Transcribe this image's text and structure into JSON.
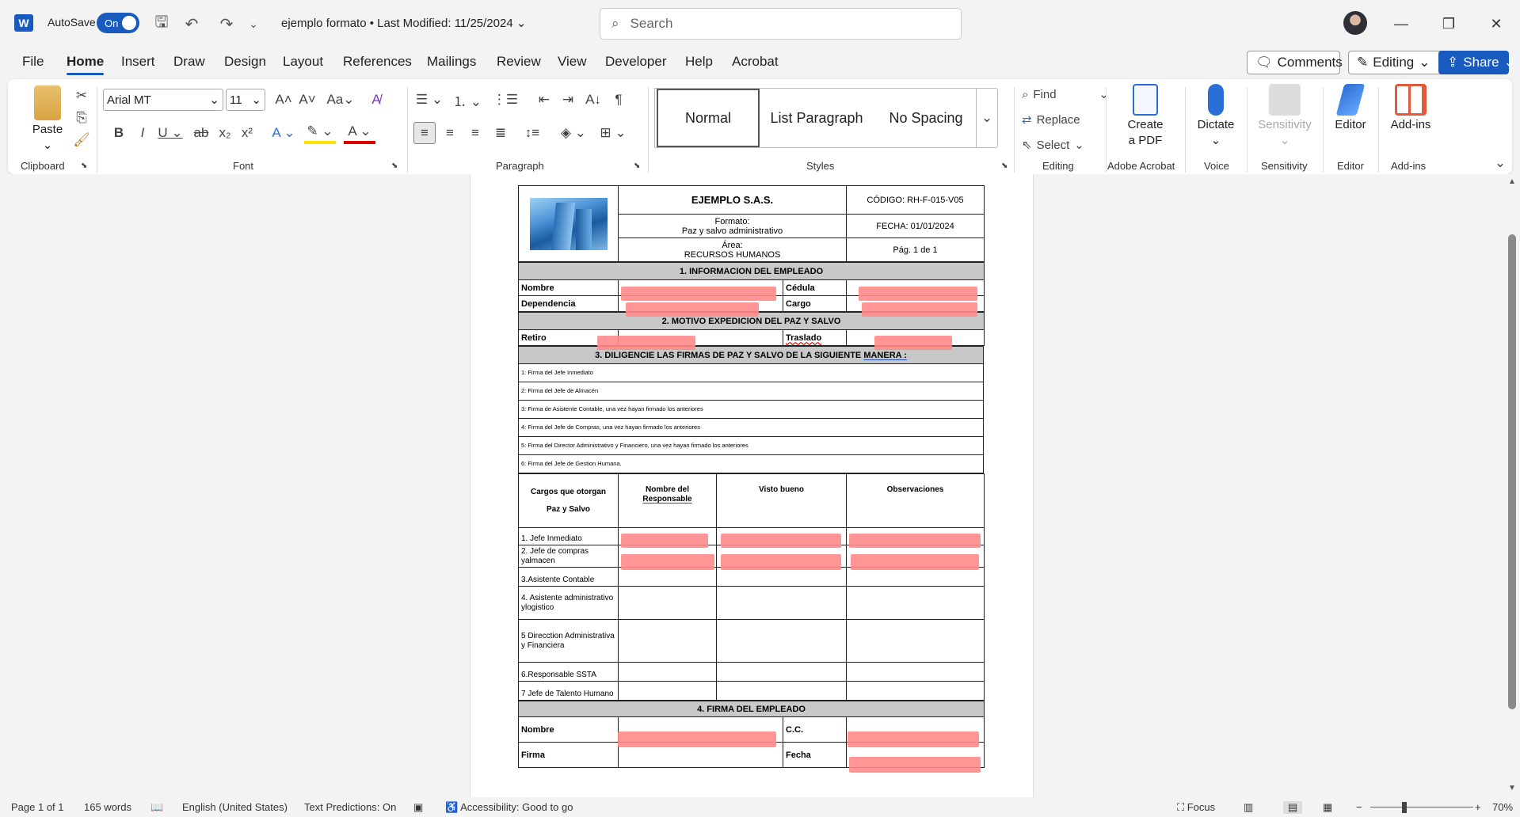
{
  "app": {
    "autosave_label": "AutoSave",
    "autosave_state": "On",
    "doc_title": "ejemplo formato",
    "last_modified": "• Last Modified: 11/25/2024",
    "search_placeholder": "Search"
  },
  "menu": [
    "File",
    "Home",
    "Insert",
    "Draw",
    "Design",
    "Layout",
    "References",
    "Mailings",
    "Review",
    "View",
    "Developer",
    "Help",
    "Acrobat"
  ],
  "menu_active": "Home",
  "actions": {
    "comments": "Comments",
    "editing": "Editing",
    "share": "Share"
  },
  "ribbon": {
    "clipboard": {
      "paste": "Paste",
      "label": "Clipboard"
    },
    "font": {
      "name": "Arial MT",
      "size": "11",
      "label": "Font"
    },
    "paragraph": {
      "label": "Paragraph"
    },
    "styles": {
      "items": [
        "Normal",
        "List Paragraph",
        "No Spacing"
      ],
      "label": "Styles"
    },
    "editing": {
      "find": "Find",
      "replace": "Replace",
      "select": "Select",
      "label": "Editing"
    },
    "acrobat": {
      "create": "Create",
      "pdf": "a PDF",
      "label": "Adobe Acrobat"
    },
    "voice": {
      "dictate": "Dictate",
      "label": "Voice"
    },
    "sensitivity": {
      "btn": "Sensitivity",
      "label": "Sensitivity"
    },
    "editor": {
      "btn": "Editor",
      "label": "Editor"
    },
    "addins": {
      "btn": "Add-ins",
      "label": "Add-ins"
    }
  },
  "doc": {
    "company": "EJEMPLO S.A.S.",
    "codigo": "CÓDIGO: RH-F-015-V05",
    "formato_label": "Formato:",
    "formato": "Paz y salvo administrativo",
    "fecha": "FECHA: 01/01/2024",
    "area_label": "Área:",
    "area": "RECURSOS HUMANOS",
    "pag": "Pág. 1  de 1",
    "s1": "1. INFORMACION DEL EMPLEADO",
    "nombre": "Nombre",
    "cedula": "Cédula",
    "dependencia": "Dependencia",
    "cargo": "Cargo",
    "s2": "2. MOTIVO EXPEDICION DEL PAZ Y SALVO",
    "retiro": "Retiro",
    "traslado": "Traslado",
    "s3_pre": "3. DILIGENCIE LAS FIRMAS DE PAZ Y SALVO DE LA SIGUIENTE ",
    "s3_u": "MANERA :",
    "steps": [
      "1: Firma del Jefe Inmediato",
      "2: Firma del Jefe de Almacén",
      "3: Firma de Asistente Contable, una vez hayan firmado los anteriores",
      "4: Firma del Jefe de Compras, una vez hayan firmado los anteriores",
      "5: Firma del  Director  Administrativo y Financiero, una vez hayan firmado los anteriores",
      "6: Firma del Jefe de  Gestion Humana."
    ],
    "th_cargos": "Cargos que otorgan",
    "th_cargos2": "Paz y Salvo",
    "th_nombre": "Nombre del",
    "th_resp": "Responsable",
    "th_visto": "Visto bueno",
    "th_obs": "Observaciones",
    "cargos": [
      "1. Jefe Inmediato",
      "2. Jefe de compras yalmacen",
      "3.Asistente Contable",
      "4. Asistente administrativo ylogistico",
      "5 Direcction Administrativa y Financiera",
      "6.Responsable SSTA",
      "7 Jefe de Talento Humano"
    ],
    "s4": "4. FIRMA DEL EMPLEADO",
    "f_nombre": "Nombre",
    "f_cc": "C.C.",
    "f_firma": "Firma",
    "f_fecha": "Fecha"
  },
  "status": {
    "page": "Page 1 of 1",
    "words": "165 words",
    "lang": "English (United States)",
    "predictions": "Text Predictions: On",
    "accessibility": "Accessibility: Good to go",
    "focus": "Focus",
    "zoom": "70%"
  }
}
